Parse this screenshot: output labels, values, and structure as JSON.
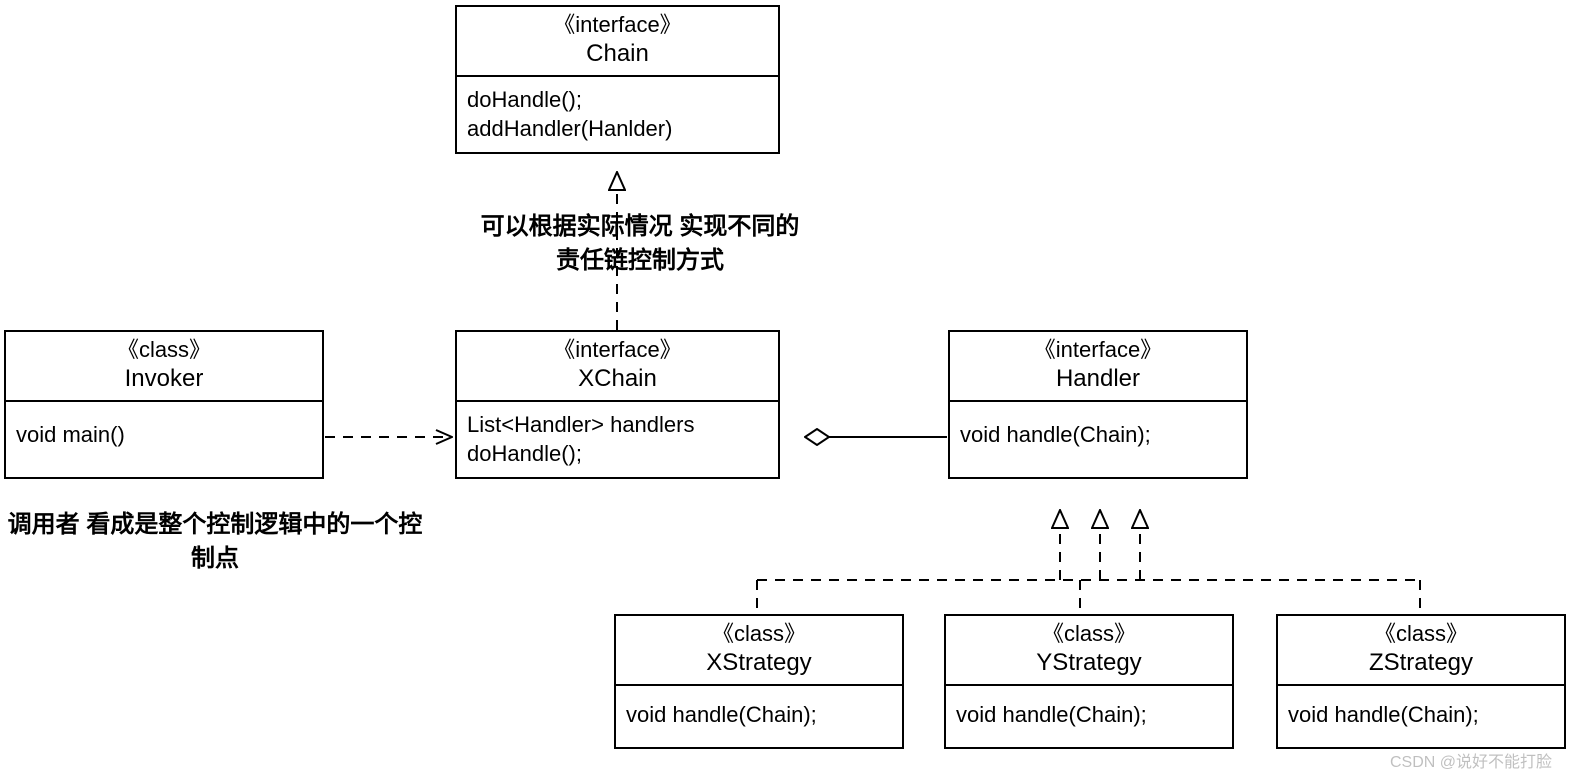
{
  "boxes": {
    "chain": {
      "stereo": "《interface》",
      "name": "Chain",
      "body": "doHandle();\naddHandler(Hanlder)"
    },
    "invoker": {
      "stereo": "《class》",
      "name": "Invoker",
      "body": "void main()"
    },
    "xchain": {
      "stereo": "《interface》",
      "name": "XChain",
      "body": "List<Handler> handlers\ndoHandle();"
    },
    "handler": {
      "stereo": "《interface》",
      "name": "Handler",
      "body": "void  handle(Chain);"
    },
    "xstrategy": {
      "stereo": "《class》",
      "name": "XStrategy",
      "body": "void  handle(Chain);"
    },
    "ystrategy": {
      "stereo": "《class》",
      "name": "YStrategy",
      "body": "void  handle(Chain);"
    },
    "zstrategy": {
      "stereo": "《class》",
      "name": "ZStrategy",
      "body": "void  handle(Chain);"
    }
  },
  "notes": {
    "chain_note": "可以根据实际情况\n实现不同的责任链控制方式",
    "invoker_note": "调用者\n看成是整个控制逻辑中的一个控制点"
  },
  "watermark": "CSDN @说好不能打脸"
}
